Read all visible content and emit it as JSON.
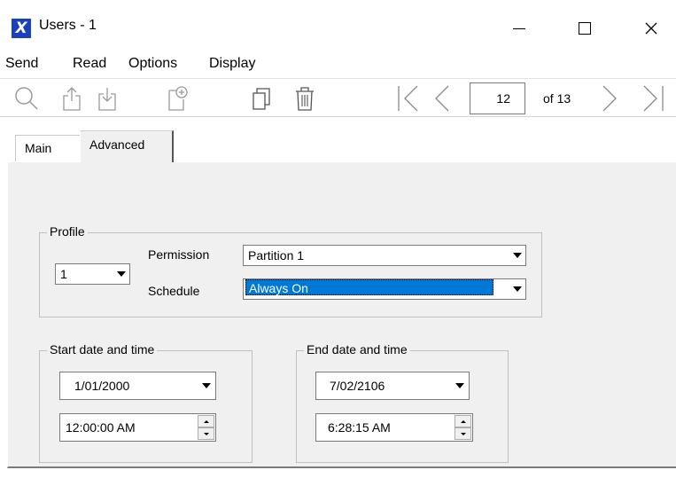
{
  "window": {
    "title": "Users - 1",
    "app_icon": "x-logo-icon",
    "controls": [
      "minimize-icon",
      "maximize-icon",
      "close-icon"
    ]
  },
  "menu": {
    "items": [
      {
        "label": "Send"
      },
      {
        "label": "Read"
      },
      {
        "label": "Options"
      },
      {
        "label": "Display"
      }
    ]
  },
  "toolbar": {
    "icons": [
      "search-icon",
      "upload-icon",
      "download-icon",
      "new-record-icon",
      "copy-icon",
      "delete-icon",
      "first-record-icon",
      "previous-record-icon",
      "next-record-icon",
      "last-record-icon"
    ],
    "record_number": "12",
    "of_label": "of 13"
  },
  "tabs": [
    {
      "label": "Main",
      "active": false
    },
    {
      "label": "Advanced",
      "active": true
    }
  ],
  "profile": {
    "group_label": "Profile",
    "profile_value": "1",
    "permission_label": "Permission",
    "permission_value": "Partition 1",
    "schedule_label": "Schedule",
    "schedule_value": "Always On"
  },
  "start": {
    "group_label": "Start date and time",
    "date": "1/01/2000",
    "time": "12:00:00 AM"
  },
  "end": {
    "group_label": "End date and time",
    "date": "7/02/2106",
    "time": "6:28:15 AM"
  },
  "colors": {
    "selection": "#0078d7",
    "panel": "#f0f0f0",
    "logo": "#1a3fbf"
  }
}
